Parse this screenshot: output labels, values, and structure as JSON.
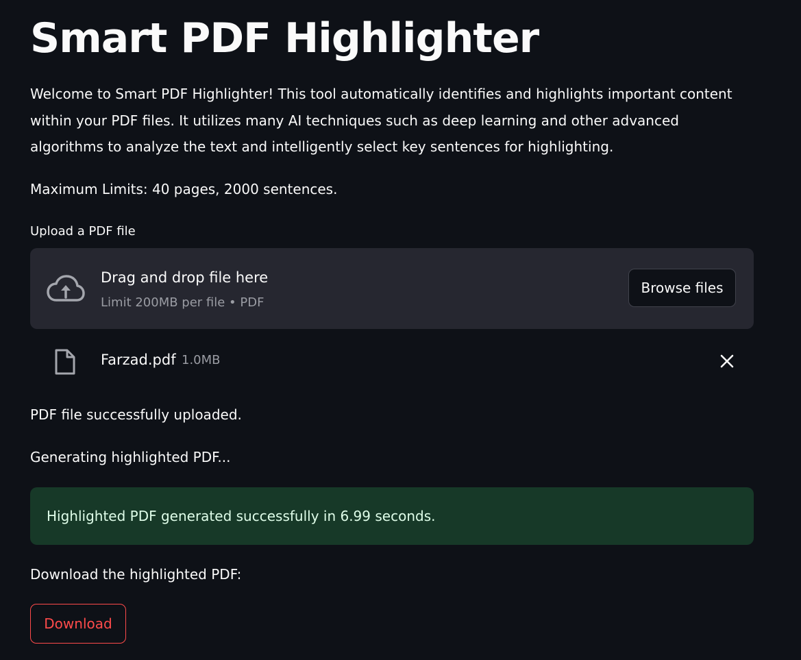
{
  "page": {
    "title": "Smart PDF Highlighter",
    "intro": "Welcome to Smart PDF Highlighter! This tool automatically identifies and highlights important content within your PDF files. It utilizes many AI techniques such as deep learning and other advanced algorithms to analyze the text and intelligently select key sentences for highlighting.",
    "limits": "Maximum Limits: 40 pages, 2000 sentences."
  },
  "uploader": {
    "label": "Upload a PDF file",
    "drop_text": "Drag and drop file here",
    "limit_text": "Limit 200MB per file • PDF",
    "browse_label": "Browse files",
    "icon": "cloud-upload-icon"
  },
  "file": {
    "name": "Farzad.pdf",
    "size": "1.0MB",
    "icon": "file-icon",
    "remove_icon": "close-icon"
  },
  "status": {
    "uploaded": "PDF file successfully uploaded.",
    "generating": "Generating highlighted PDF...",
    "success": "Highlighted PDF generated successfully in 6.99 seconds.",
    "download_prompt": "Download the highlighted PDF:"
  },
  "download": {
    "label": "Download"
  },
  "colors": {
    "background": "#0e1117",
    "dropzone": "#262730",
    "success_bg": "#173928",
    "success_text": "#dffde9",
    "accent": "#ff4b4b"
  }
}
